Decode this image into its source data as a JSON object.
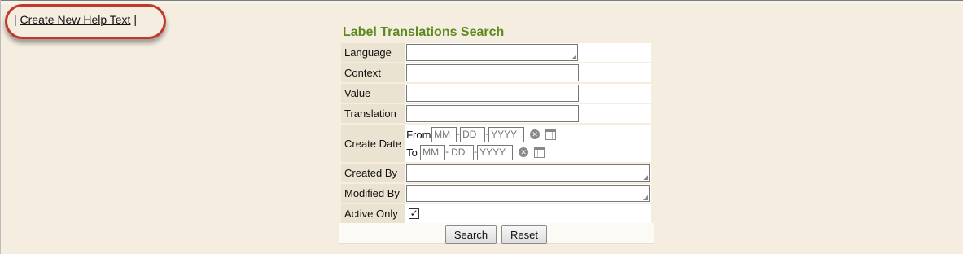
{
  "links": {
    "prefix": "|",
    "create_help_text": "Create New Help Text",
    "suffix": "|"
  },
  "panel": {
    "title": "Label Translations Search"
  },
  "fields": {
    "language": {
      "label": "Language",
      "value": ""
    },
    "context": {
      "label": "Context",
      "value": ""
    },
    "value": {
      "label": "Value",
      "value": ""
    },
    "translation": {
      "label": "Translation",
      "value": ""
    },
    "create_date": {
      "label": "Create Date",
      "from_label": "From",
      "to_label": "To",
      "mm_placeholder": "MM",
      "dd_placeholder": "DD",
      "yyyy_placeholder": "YYYY",
      "separator": "-"
    },
    "created_by": {
      "label": "Created By",
      "value": ""
    },
    "modified_by": {
      "label": "Modified By",
      "value": ""
    },
    "active_only": {
      "label": "Active Only",
      "checked": true,
      "check_glyph": "✓"
    }
  },
  "buttons": {
    "search": "Search",
    "reset": "Reset"
  },
  "icons": {
    "clear": "clear-date-icon",
    "calendar": "calendar-icon",
    "clear_glyph": "✕"
  },
  "colors": {
    "background": "#f4ede0",
    "title": "#5c8a1e",
    "highlight_ring": "#c0392b",
    "label_cell": "#ebe3d2"
  }
}
